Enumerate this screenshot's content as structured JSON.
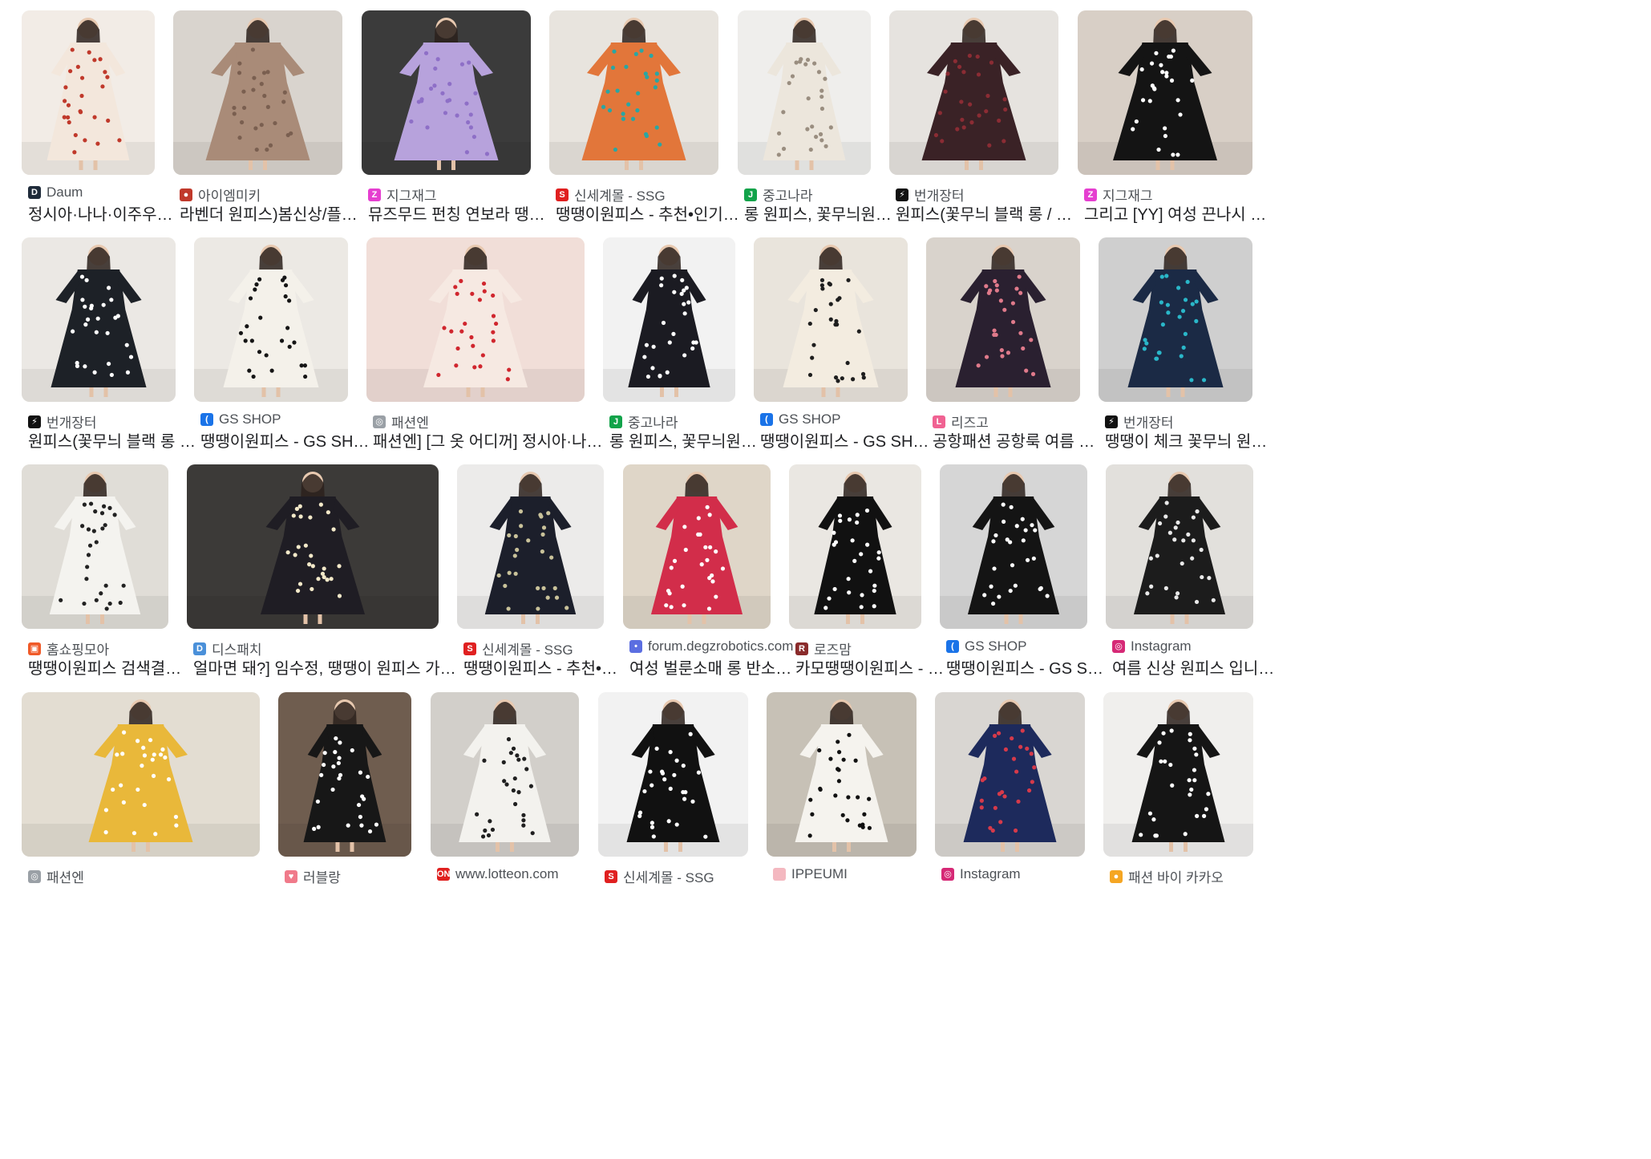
{
  "results": [
    {
      "source": "Daum",
      "title": "정시아·나나·이주우, …",
      "favicon": "d-icon",
      "fav_color": "#1f2b3a",
      "bg": "#f2ece6",
      "dress": "#f3e7dc",
      "dot": "#c0392b"
    },
    {
      "source": "아이엠미키",
      "title": "라벤더 원피스)봄신상/플라…",
      "favicon": "mouse-icon",
      "fav_color": "#c0392b",
      "bg": "#d9d4ce",
      "dress": "#a98b78",
      "dot": "#7a5f50"
    },
    {
      "source": "지그재그",
      "title": "뮤즈무드 펀칭 연보라 땡땡…",
      "favicon": "z-icon",
      "fav_color": "#e53fd0",
      "bg": "#3b3b3b",
      "dress": "#b7a2dc",
      "dot": "#8e6fc7"
    },
    {
      "source": "신세계몰 - SSG",
      "title": "땡땡이원피스 - 추천•인기 …",
      "favicon": "ssg-icon",
      "fav_color": "#e02020",
      "bg": "#e8e4de",
      "dress": "#e2763a",
      "dot": "#2aa6a3"
    },
    {
      "source": "중고나라",
      "title": "롱 원피스, 꽃무늬원…",
      "favicon": "joongna-icon",
      "fav_color": "#12a34a",
      "bg": "#efeeec",
      "dress": "#ece6dc",
      "dot": "#9a8e80"
    },
    {
      "source": "번개장터",
      "title": "원피스(꽃무늬 블랙 롱 / 땡…",
      "favicon": "bolt-icon",
      "fav_color": "#111111",
      "bg": "#e6e3df",
      "dress": "#3a2226",
      "dot": "#8b2c34"
    },
    {
      "source": "지그재그",
      "title": "그리고 [YY] 여성 끈나시 롱 …",
      "favicon": "z-icon",
      "fav_color": "#e53fd0",
      "bg": "#d8cfc6",
      "dress": "#141414",
      "dot": "#ffffff"
    },
    {
      "source": "번개장터",
      "title": "원피스(꽃무늬 블랙 롱 / …",
      "favicon": "bolt-icon",
      "fav_color": "#111111",
      "bg": "#ebe8e4",
      "dress": "#1d2127",
      "dot": "#ffffff"
    },
    {
      "source": "GS SHOP",
      "title": "땡땡이원피스 - GS SHOP",
      "favicon": "gs-icon",
      "fav_color": "#1a73e8",
      "bg": "#ece9e4",
      "dress": "#f4f1ea",
      "dot": "#151515"
    },
    {
      "source": "패션엔",
      "title": "패션엔] [그 옷 어디꺼] 정시아·나나·…",
      "favicon": "globe-icon",
      "fav_color": "#9aa0a6",
      "bg": "#f1ded8",
      "dress": "#f6e9e2",
      "dot": "#d0262e"
    },
    {
      "source": "중고나라",
      "title": "롱 원피스, 꽃무늬원…",
      "favicon": "joongna-icon",
      "fav_color": "#12a34a",
      "bg": "#f2f2f2",
      "dress": "#1b1b22",
      "dot": "#ffffff"
    },
    {
      "source": "GS SHOP",
      "title": "땡땡이원피스 - GS SHOP",
      "favicon": "gs-icon",
      "fav_color": "#1a73e8",
      "bg": "#e9e4dc",
      "dress": "#f3ece0",
      "dot": "#1e1e1e"
    },
    {
      "source": "리즈고",
      "title": "공항패션 공항룩 여름 꽃…",
      "favicon": "l-icon",
      "fav_color": "#f06292",
      "bg": "#d9d3cc",
      "dress": "#2a2030",
      "dot": "#e07a8b"
    },
    {
      "source": "번개장터",
      "title": "땡땡이 체크 꽃무늬 원피…",
      "favicon": "bolt-icon",
      "fav_color": "#111111",
      "bg": "#cfcfcf",
      "dress": "#1b2a45",
      "dot": "#2ab7c9"
    },
    {
      "source": "홈쇼핑모아",
      "title": "땡땡이원피스 검색결과…",
      "favicon": "tv-icon",
      "fav_color": "#f05a28",
      "bg": "#e0ddd7",
      "dress": "#f4f3ef",
      "dot": "#222222"
    },
    {
      "source": "디스패치",
      "title": "얼마면 돼?] 임수정, 땡땡이 원피스 가격은…",
      "favicon": "d-icon",
      "fav_color": "#4a90d9",
      "bg": "#3c3a38",
      "dress": "#1f1d24",
      "dot": "#f3e9c9"
    },
    {
      "source": "신세계몰 - SSG",
      "title": "땡땡이원피스 - 추천•인…",
      "favicon": "ssg-icon",
      "fav_color": "#e02020",
      "bg": "#ecebea",
      "dress": "#1c1f2b",
      "dot": "#c9c29a"
    },
    {
      "source": "forum.degzrobotics.com",
      "title": "여성 벌룬소매 롱 반소…",
      "favicon": "forum-icon",
      "fav_color": "#5b6ee1",
      "bg": "#dfd6c8",
      "dress": "#d22d4a",
      "dot": "#ffffff"
    },
    {
      "source": "로즈맘",
      "title": "카모땡땡이원피스 - …",
      "favicon": "r-icon",
      "fav_color": "#8a2b2b",
      "bg": "#eae7e2",
      "dress": "#111111",
      "dot": "#ffffff"
    },
    {
      "source": "GS SHOP",
      "title": "땡땡이원피스 - GS SH…",
      "favicon": "gs-icon",
      "fav_color": "#1a73e8",
      "bg": "#d6d6d6",
      "dress": "#141414",
      "dot": "#ffffff"
    },
    {
      "source": "Instagram",
      "title": "여름 신상 원피스 입니…",
      "favicon": "instagram-icon",
      "fav_color": "#d62976",
      "bg": "#e2e0dc",
      "dress": "#1c1c1c",
      "dot": "#e9e9e9"
    },
    {
      "source": "패션엔",
      "title": "",
      "favicon": "globe-icon",
      "fav_color": "#9aa0a6",
      "bg": "#e3ddd2",
      "dress": "#e9b83a",
      "dot": "#ffffff"
    },
    {
      "source": "러블랑",
      "title": "",
      "favicon": "heart-icon",
      "fav_color": "#f07a8a",
      "bg": "#6f5d4f",
      "dress": "#171717",
      "dot": "#ffffff"
    },
    {
      "source": "www.lotteon.com",
      "title": "",
      "favicon": "on-icon",
      "fav_color": "#e0201f",
      "bg": "#d2cfca",
      "dress": "#f3f2ee",
      "dot": "#202020"
    },
    {
      "source": "신세계몰 - SSG",
      "title": "",
      "favicon": "ssg-icon",
      "fav_color": "#e02020",
      "bg": "#f2f2f2",
      "dress": "#111111",
      "dot": "#ffffff"
    },
    {
      "source": "IPPEUMI",
      "title": "",
      "favicon": "ippeumi-icon",
      "fav_color": "#f4b8c0",
      "bg": "#c7c1b6",
      "dress": "#f5f3ee",
      "dot": "#111111"
    },
    {
      "source": "Instagram",
      "title": "",
      "favicon": "instagram-icon",
      "fav_color": "#d62976",
      "bg": "#d9d6d2",
      "dress": "#1d2a5c",
      "dot": "#d63a4a"
    },
    {
      "source": "패션 바이 카카오",
      "title": "",
      "favicon": "kakao-icon",
      "fav_color": "#f5a623",
      "bg": "#f0efed",
      "dress": "#151515",
      "dot": "#ffffff"
    }
  ]
}
